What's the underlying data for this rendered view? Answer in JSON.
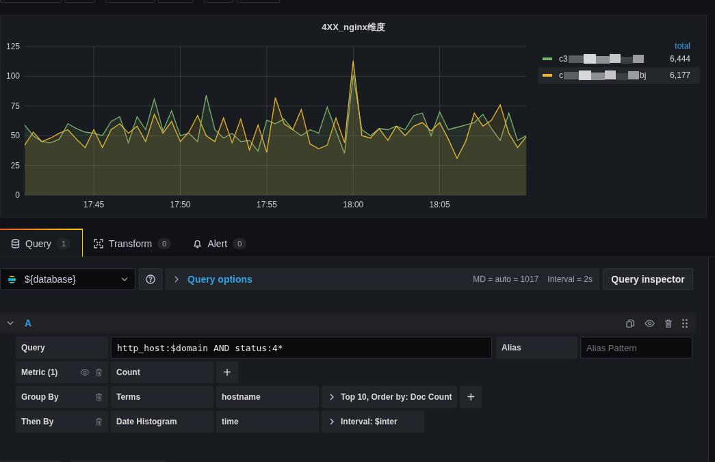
{
  "panel": {
    "title": "4XX_nginx维度",
    "chart_data": {
      "type": "area",
      "grid": true,
      "ylim": [
        0,
        125
      ],
      "yticks": [
        0,
        25,
        50,
        75,
        100,
        125
      ],
      "categories": [
        null,
        null,
        null,
        null,
        null,
        null,
        null,
        null,
        "17:45",
        null,
        null,
        null,
        null,
        null,
        null,
        null,
        null,
        null,
        "17:50",
        null,
        null,
        null,
        null,
        null,
        null,
        null,
        null,
        null,
        "17:55",
        null,
        null,
        null,
        null,
        null,
        null,
        null,
        null,
        null,
        "18:00",
        null,
        null,
        null,
        null,
        null,
        null,
        null,
        null,
        null,
        "18:05",
        null,
        null,
        null,
        null,
        null,
        null,
        null,
        null,
        null,
        null
      ],
      "series": [
        {
          "color": "#7eb26d",
          "values": [
            59,
            50,
            45,
            44,
            47,
            60,
            56,
            53,
            52,
            50,
            62,
            66,
            44,
            66,
            55,
            81,
            54,
            71,
            50,
            52,
            45,
            84,
            55,
            48,
            52,
            45,
            46,
            37,
            63,
            60,
            64,
            55,
            50,
            55,
            52,
            74,
            54,
            35,
            101,
            55,
            50,
            56,
            55,
            58,
            55,
            67,
            69,
            50,
            70,
            55,
            57,
            59,
            61,
            68,
            56,
            46,
            69,
            46,
            50
          ]
        },
        {
          "color": "#eab839",
          "values": [
            42,
            53,
            45,
            48,
            52,
            55,
            47,
            40,
            55,
            40,
            55,
            60,
            52,
            58,
            45,
            68,
            52,
            62,
            45,
            53,
            67,
            50,
            45,
            65,
            44,
            64,
            38,
            59,
            36,
            82,
            60,
            55,
            72,
            43,
            39,
            42,
            65,
            44,
            113,
            50,
            48,
            56,
            46,
            58,
            50,
            58,
            61,
            54,
            61,
            47,
            31,
            45,
            69,
            58,
            63,
            76,
            52,
            40,
            49
          ]
        }
      ]
    },
    "legend": {
      "header": "total",
      "items": [
        {
          "name": "c3",
          "total": "6,444",
          "color": "#7eb26d",
          "hovered": false
        },
        {
          "name": "c",
          "suffix": "bj",
          "total": "6,177",
          "color": "#eab839",
          "hovered": true
        }
      ]
    }
  },
  "tabs": [
    {
      "label": "Query",
      "count": "1",
      "selected": true
    },
    {
      "label": "Transform",
      "count": "0",
      "selected": false
    },
    {
      "label": "Alert",
      "count": "0",
      "selected": false
    }
  ],
  "datasource": {
    "value": "${database}"
  },
  "query_options": {
    "label": "Query options",
    "max_data_points": "MD = auto = 1017",
    "interval": "Interval = 2s"
  },
  "inspector_button": "Query inspector",
  "query": {
    "ref_id": "A",
    "expanded": true,
    "query_row": {
      "label": "Query",
      "value": "http_host:$domain AND status:4*",
      "alias_label": "Alias",
      "alias_placeholder": "Alias Pattern"
    },
    "rows": [
      {
        "kind": "metric",
        "label": "Metric (1)",
        "cells": [
          {
            "text": "Count",
            "expandable": false
          }
        ],
        "add": "+"
      },
      {
        "kind": "bucket",
        "label": "Group By",
        "cells": [
          {
            "text": "Terms",
            "expandable": false
          },
          {
            "text": "hostname",
            "expandable": false
          },
          {
            "text": "Top 10, Order by: Doc Count",
            "expandable": true
          }
        ],
        "add": "+"
      },
      {
        "kind": "bucket",
        "label": "Then By",
        "cells": [
          {
            "text": "Date Histogram",
            "expandable": false
          },
          {
            "text": "time",
            "expandable": false
          },
          {
            "text": "Interval: $inter",
            "expandable": true
          }
        ]
      }
    ]
  }
}
